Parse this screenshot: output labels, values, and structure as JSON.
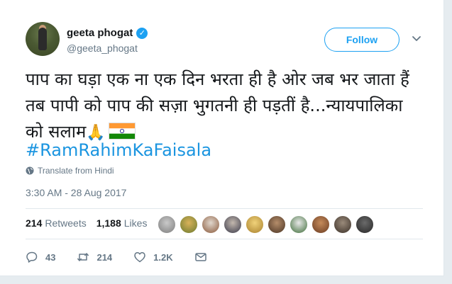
{
  "author": {
    "name": "geeta phogat",
    "handle": "@geeta_phogat",
    "verified": true
  },
  "follow_label": "Follow",
  "tweet": {
    "text": "पाप का घड़ा एक ना एक दिन भरता ही है ओर जब भर जाता हैं तब पापी को पाप की सज़ा भुगतनी ही पड़तीं है...न्यायपालिका को सलाम",
    "emoji": "🙏",
    "flag": "india-flag",
    "hashtag": "#RamRahimKaFaisala",
    "translate_label": "Translate from Hindi",
    "timestamp": "3:30 AM - 28 Aug 2017"
  },
  "stats": {
    "retweets_count": "214",
    "retweets_label": "Retweets",
    "likes_count": "1,188",
    "likes_label": "Likes"
  },
  "liker_avatars": [
    "avatar-1",
    "avatar-2",
    "avatar-3",
    "avatar-4",
    "avatar-5",
    "avatar-6",
    "avatar-7",
    "avatar-8",
    "avatar-9",
    "avatar-10"
  ],
  "actions": {
    "reply_count": "43",
    "retweet_count": "214",
    "like_count": "1.2K"
  },
  "colors": {
    "accent": "#1da1f2",
    "hashtag": "#1b95e0",
    "secondary_text": "#657786",
    "divider": "#e1e8ed"
  }
}
